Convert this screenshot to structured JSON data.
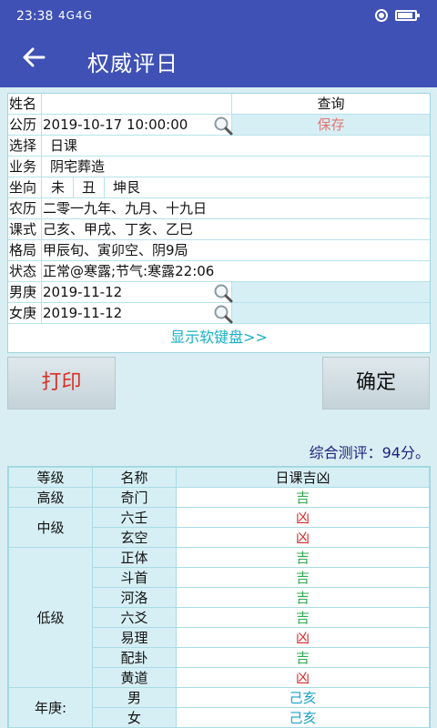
{
  "status_bar": {
    "time": "23:38",
    "signal": "4G4G"
  },
  "app_bar": {
    "back_icon": "arrow-left-icon",
    "title": "权威评日"
  },
  "form": {
    "name_label": "姓名",
    "query_label": "查询",
    "calendar_label": "公历",
    "calendar_value": "2019-10-17  10:00:00",
    "save_label": "保存",
    "choose_label": "选择",
    "choose_value": "日课",
    "business_label": "业务",
    "business_value": "阴宅葬造",
    "direction_label": "坐向",
    "direction_values": [
      "未",
      "丑",
      "坤艮"
    ],
    "lunar_label": "农历",
    "lunar_value": "二零一九年、九月、十九日",
    "course_label": "课式",
    "course_value": "己亥、甲戌、丁亥、乙巳",
    "pattern_label": "格局",
    "pattern_value": "甲辰旬、寅卯空、阴9局",
    "state_label": "状态",
    "state_value": "正常@寒露;节气:寒露22:06",
    "male_label": "男庚",
    "male_value": "2019-11-12",
    "female_label": "女庚",
    "female_value": "2019-11-12",
    "keyboard_label": "显示软键盘>>"
  },
  "buttons": {
    "print": "打印",
    "confirm": "确定"
  },
  "score": "综合测评：94分。",
  "result_table": {
    "headers": [
      "等级",
      "名称",
      "日课吉凶"
    ],
    "grades": {
      "high": "高级",
      "mid": "中级",
      "low": "低级",
      "year": "年庚:"
    },
    "rows": [
      {
        "name": "奇门",
        "result": "吉"
      },
      {
        "name": "六壬",
        "result": "凶"
      },
      {
        "name": "玄空",
        "result": "凶"
      },
      {
        "name": "正体",
        "result": "吉"
      },
      {
        "name": "斗首",
        "result": "吉"
      },
      {
        "name": "河洛",
        "result": "吉"
      },
      {
        "name": "六爻",
        "result": "吉"
      },
      {
        "name": "易理",
        "result": "凶"
      },
      {
        "name": "配卦",
        "result": "吉"
      },
      {
        "name": "黄道",
        "result": "凶"
      },
      {
        "name": "男",
        "result": "己亥"
      },
      {
        "name": "女",
        "result": "己亥"
      }
    ]
  },
  "colors": {
    "primary": "#3f51b5",
    "good": "#2eaa4f",
    "bad": "#d32f2f",
    "accent": "#1aa1c6"
  }
}
